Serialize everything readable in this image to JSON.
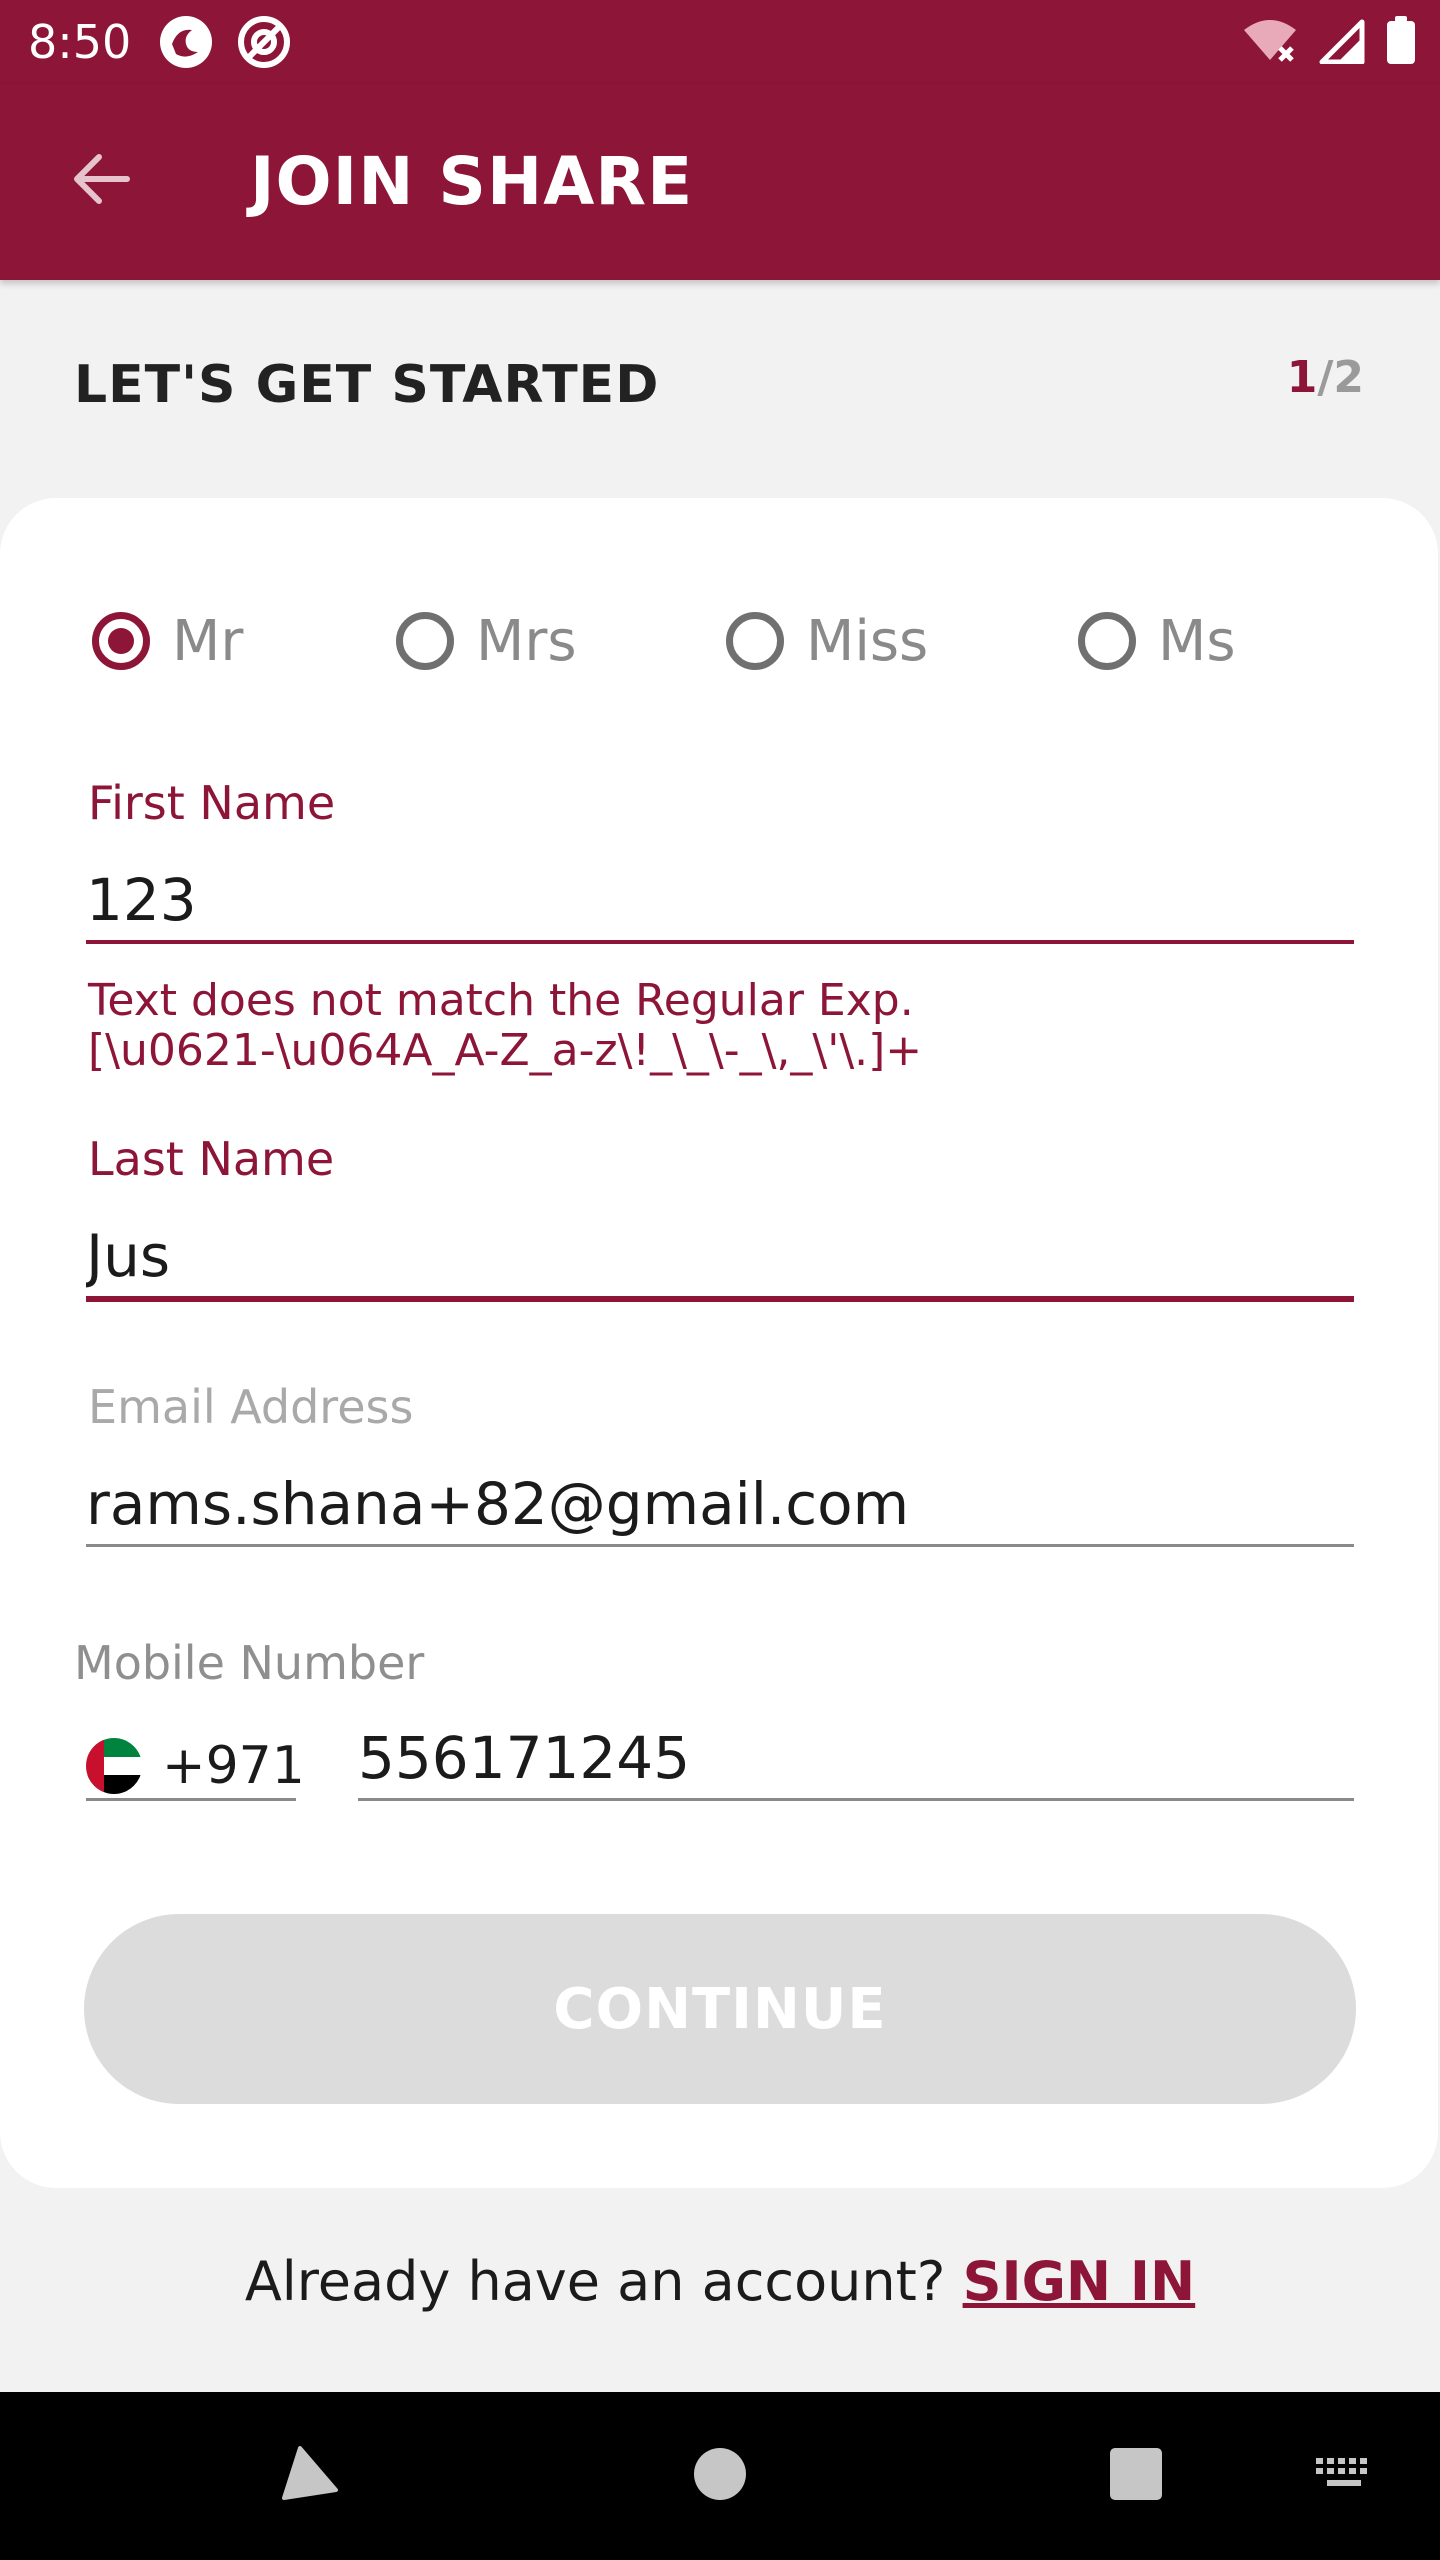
{
  "status_bar": {
    "time": "8:50"
  },
  "app_bar": {
    "title": "JOIN SHARE"
  },
  "header": {
    "heading": "LET'S GET STARTED",
    "step_current": "1",
    "step_total": "/2"
  },
  "title_options": [
    {
      "label": "Mr",
      "selected": true
    },
    {
      "label": "Mrs",
      "selected": false
    },
    {
      "label": "Miss",
      "selected": false
    },
    {
      "label": "Ms",
      "selected": false
    }
  ],
  "form": {
    "first_name": {
      "label": "First Name",
      "value": "123",
      "error_line1": "Text does not match the Regular Exp.",
      "error_line2": "[\\u0621-\\u064A_A-Z_a-z\\!_\\_\\-_\\,_\\'\\.]+"
    },
    "last_name": {
      "label": "Last Name",
      "value": "Jus"
    },
    "email": {
      "label": "Email Address",
      "value": "rams.shana+82@gmail.com"
    },
    "mobile": {
      "label": "Mobile Number",
      "country_code": "+971",
      "value": "556171245"
    }
  },
  "actions": {
    "continue_label": "CONTINUE",
    "signin_prompt": "Already have an account? ",
    "signin_label": "SIGN IN"
  },
  "colors": {
    "brand": "#8c1538",
    "disabled_button": "#dcdcdc",
    "page_background": "#f2f2f3"
  },
  "icons": {
    "back": "arrow-left-icon",
    "flag": "uae-flag-icon",
    "nav_back": "triangle-back-icon",
    "nav_home": "circle-home-icon",
    "nav_recents": "square-recents-icon",
    "nav_keyboard": "keyboard-icon"
  }
}
